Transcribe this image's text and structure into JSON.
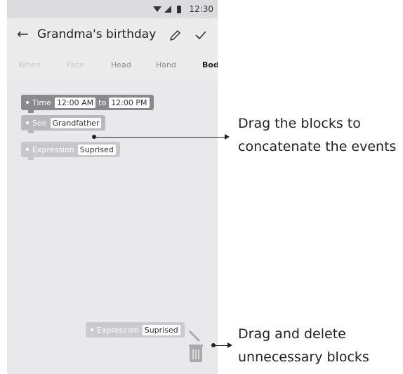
{
  "status_bar": {
    "time": "12:30",
    "icons": [
      "wifi-icon",
      "cell-signal-icon",
      "battery-icon"
    ]
  },
  "toolbar": {
    "title": "Grandma's birthday",
    "back_icon": "arrow-left-icon",
    "edit_icon": "pencil-icon",
    "confirm_icon": "check-icon"
  },
  "tabs": [
    {
      "label": "When"
    },
    {
      "label": "Face"
    },
    {
      "label": "Head"
    },
    {
      "label": "Hand"
    },
    {
      "label": "Bod"
    }
  ],
  "blocks": {
    "time": {
      "label": "Time",
      "from": "12:00 AM",
      "joiner": "to",
      "to": "12:00 PM"
    },
    "see": {
      "label": "See",
      "value": "Grandfather"
    },
    "expression": {
      "label": "Expression",
      "value": "Suprised"
    },
    "dragging": {
      "label": "Expression",
      "value": "Suprised"
    }
  },
  "annotations": {
    "concat_line1": "Drag the blocks to",
    "concat_line2": "concatenate the events",
    "delete_line1": "Drag and delete",
    "delete_line2": "unnecessary blocks"
  }
}
